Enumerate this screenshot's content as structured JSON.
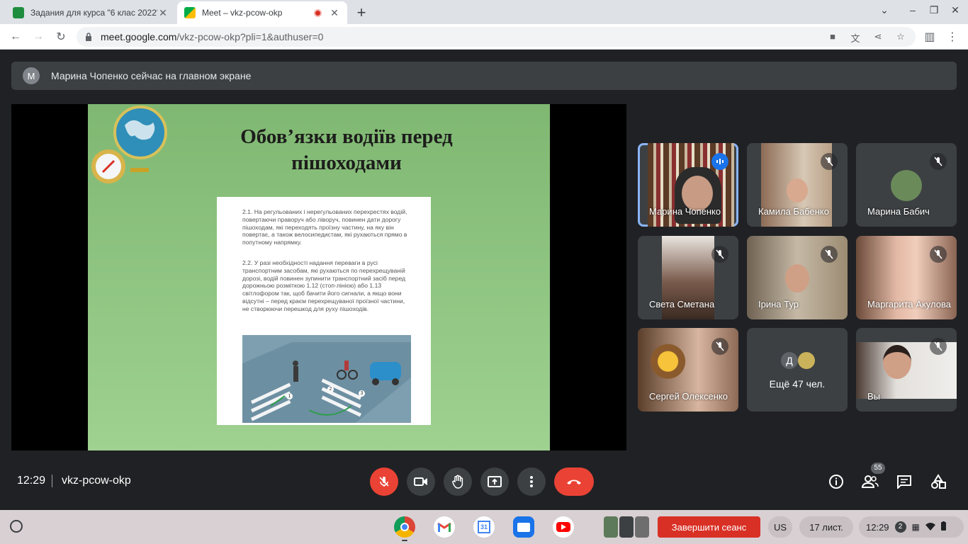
{
  "browser": {
    "tabs": [
      {
        "title": "Задания для курса \"6 клас 2022\"",
        "active": false
      },
      {
        "title": "Meet – vkz-pcow-okp",
        "active": true
      }
    ],
    "url_host": "meet.google.com",
    "url_path": "/vkz-pcow-okp?pli=1&authuser=0"
  },
  "meet": {
    "banner": {
      "avatar_letter": "М",
      "text": "Марина Чопенко сейчас на главном экране"
    },
    "slide": {
      "title": "Обов’язки водіїв перед пішоходами",
      "para1": "2.1. На регульованих і нерегульованих перехрестях водій, повертаючи праворуч або ліворуч, повинен дати дорогу пішоходам, які переходять проїзну частину, на яку він повертає, а також велосипедистам, які рухаються прямо в попутному напрямку.",
      "para2": "2.2. У разі необхідності надання переваги в русі транспортним засобам, які рухаються по перехрещуваній дорозі, водій повинен зупинити транспортний засіб перед дорожньою розміткою 1.12 (стоп-лінією) або 1.13 світлофором так, щоб бачити його сигнали, а якщо вони відсутні – перед краєм перехрещуваної проїзної частини, не створюючи перешкод для руху пішоходів.",
      "markers": [
        "1",
        "2",
        "3"
      ]
    },
    "participants": [
      {
        "name": "Марина Чопенко",
        "speaking": true
      },
      {
        "name": "Камила Бабенко",
        "muted": true
      },
      {
        "name": "Марина Бабич",
        "muted": true
      },
      {
        "name": "Света Сметана",
        "muted": true
      },
      {
        "name": "Ірина Тур",
        "muted": true
      },
      {
        "name": "Маргарита Акулова",
        "muted": true
      },
      {
        "name": "Сергей Олексенко",
        "muted": true
      },
      {
        "name": "Вы",
        "muted": true
      }
    ],
    "more": {
      "avatar_letter": "Д",
      "label": "Ещё 47 чел."
    },
    "bottom": {
      "time": "12:29",
      "code": "vkz-pcow-okp",
      "people_count": "55"
    },
    "colors": {
      "hangup": "#ea4335",
      "speaking": "#8ab4f8",
      "tile_bg": "#3c4043"
    }
  },
  "os_shelf": {
    "end_session": "Завершити сеанс",
    "lang": "US",
    "date": "17 лист.",
    "time": "12:29",
    "notifications": "2",
    "apps": [
      "chrome-icon",
      "gmail-icon",
      "calendar-icon",
      "files-icon",
      "youtube-icon"
    ]
  }
}
